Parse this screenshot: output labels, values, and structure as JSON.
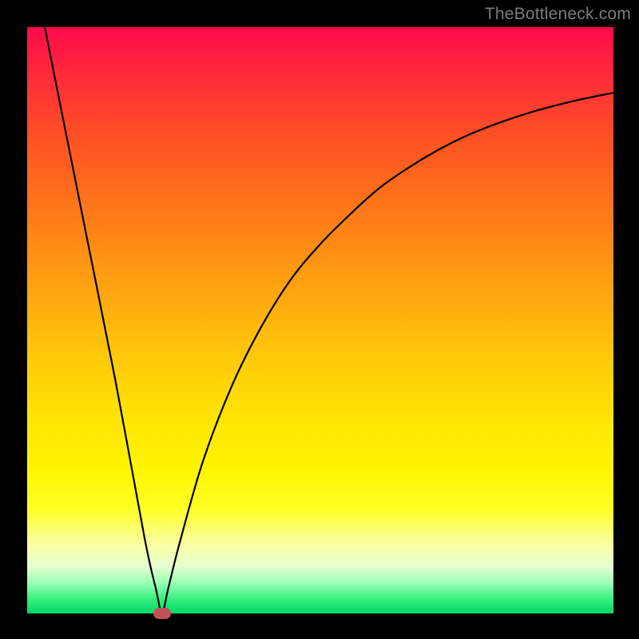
{
  "watermark": "TheBottleneck.com",
  "chart_data": {
    "type": "line",
    "title": "",
    "xlabel": "",
    "ylabel": "",
    "xlim": [
      0,
      100
    ],
    "ylim": [
      0,
      100
    ],
    "grid": false,
    "legend": null,
    "min_marker": {
      "x": 23,
      "y": 0
    },
    "series": [
      {
        "name": "bottleneck-curve",
        "x": [
          0,
          5,
          10,
          15,
          20,
          22,
          23,
          24,
          26,
          30,
          35,
          40,
          45,
          50,
          55,
          60,
          65,
          70,
          75,
          80,
          85,
          90,
          95,
          100
        ],
        "values": [
          115,
          90,
          65,
          40,
          13,
          4,
          0,
          4,
          12,
          26,
          39,
          49,
          57,
          63,
          68,
          72.5,
          76,
          79,
          81.5,
          83.5,
          85.2,
          86.6,
          87.8,
          88.8
        ]
      }
    ],
    "background_gradient": {
      "top": "#ff0a4c",
      "upper_mid": "#ffa210",
      "lower_mid": "#fff500",
      "bottom": "#00d766"
    }
  }
}
